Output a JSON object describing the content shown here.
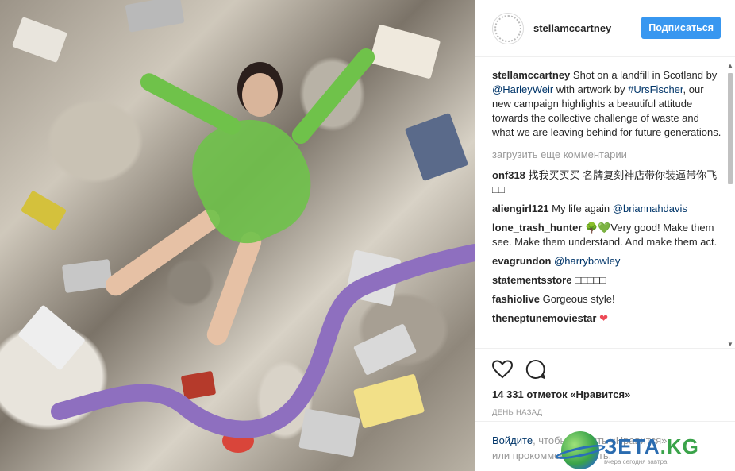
{
  "post": {
    "username": "stellamccartney",
    "follow_label": "Подписаться"
  },
  "caption": {
    "user": "stellamccartney",
    "text_1": "Shot on a landfill in Scotland by ",
    "mention_1": "@HarleyWeir",
    "text_2": " with artwork by ",
    "hashtag": "#UrsFischer",
    "text_3": ", our new campaign highlights a beautiful attitude towards the collective challenge of waste and what we are leaving behind for future generations."
  },
  "load_more": "загрузить еще комментарии",
  "comments": [
    {
      "user": "onf318",
      "text": "找我买买买 名牌复刻神店带你装逼带你飞□□"
    },
    {
      "user": "aliengirl121",
      "text": "My life again ",
      "mention": "@briannahdavis"
    },
    {
      "user": "lone_trash_hunter",
      "text": "🌳💚Very good! Make them see. Make them understand. And make them act."
    },
    {
      "user": "evagrundon",
      "text": "",
      "mention": "@harrybowley"
    },
    {
      "user": "statementsstore",
      "text": "□□□□□"
    },
    {
      "user": "fashiolive",
      "text": "Gorgeous style!"
    },
    {
      "user": "theneptunemoviestar",
      "text": "❤"
    }
  ],
  "actions": {
    "likes": "14 331 отметок «Нравится»",
    "time": "ДЕНЬ НАЗАД"
  },
  "login": {
    "link": "Войдите",
    "text_1": ", чтобы ставить «Нравится»",
    "text_2": "или прокомментировать."
  },
  "watermark": {
    "title": "ЗЕТА",
    "domain": ".KG",
    "tagline": "вчера сегодня завтра"
  },
  "colors": {
    "follow_button": "#3897f0",
    "link": "#003569",
    "muted": "#999999",
    "heart": "#ed4956"
  }
}
